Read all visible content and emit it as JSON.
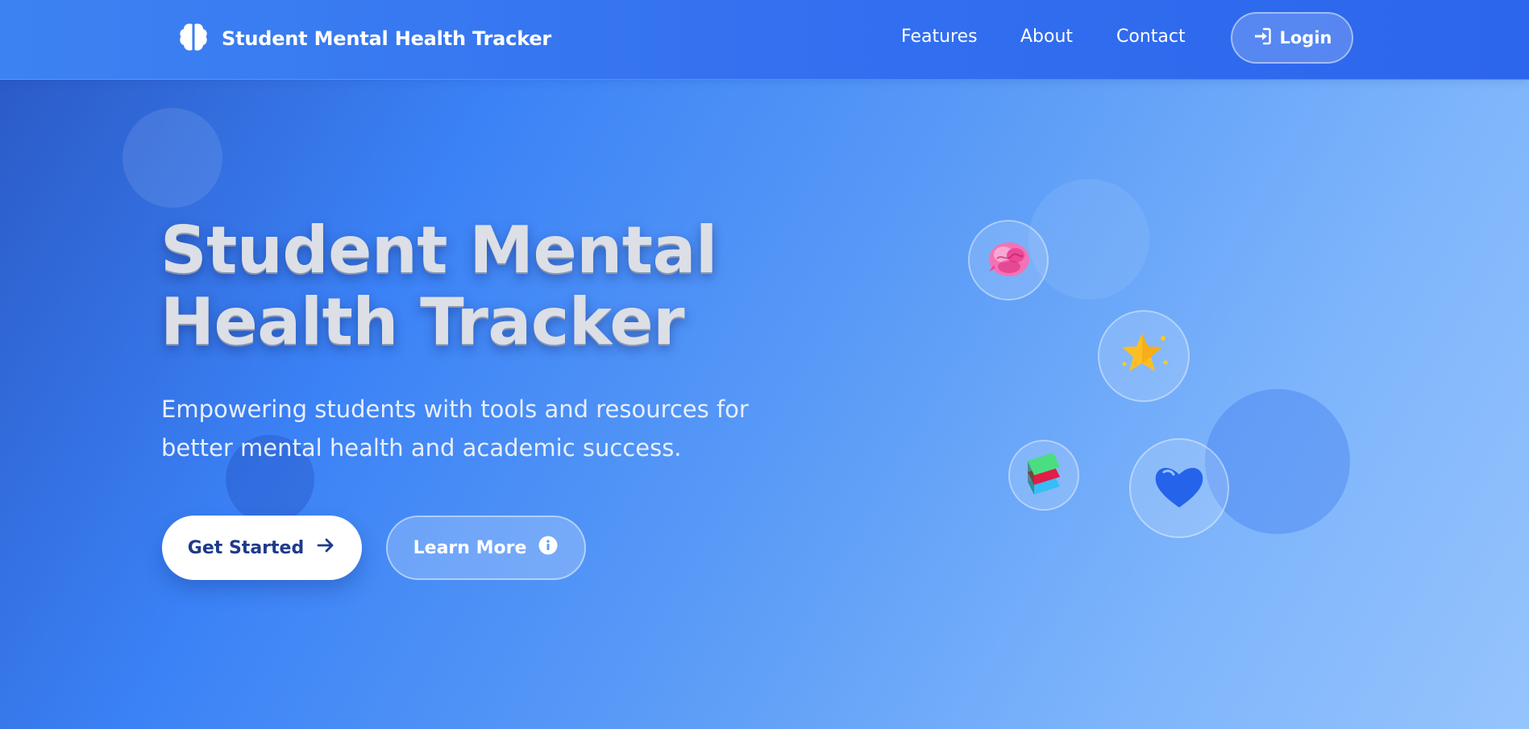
{
  "header": {
    "brand_title": "Student Mental Health Tracker",
    "brand_icon": "brain-icon",
    "nav": [
      {
        "label": "Features"
      },
      {
        "label": "About"
      },
      {
        "label": "Contact"
      }
    ],
    "login_label": "Login",
    "login_icon": "sign-in-icon"
  },
  "hero": {
    "title_line1": "Student Mental",
    "title_line2": "Health Tracker",
    "subtitle_line1": "Empowering students with tools and resources for",
    "subtitle_line2": "better mental health and academic success.",
    "primary_button": {
      "label": "Get Started",
      "icon": "arrow-right-icon"
    },
    "secondary_button": {
      "label": "Learn More",
      "icon": "info-circle-icon"
    }
  },
  "floating_icons": [
    "brain-emoji-icon",
    "star-emoji-icon",
    "books-emoji-icon",
    "blue-heart-emoji-icon"
  ],
  "colors": {
    "accent_blue": "#3b82f6",
    "nav_blue": "#336ff0",
    "button_text_dark": "#1e3a8a",
    "white": "#ffffff"
  }
}
